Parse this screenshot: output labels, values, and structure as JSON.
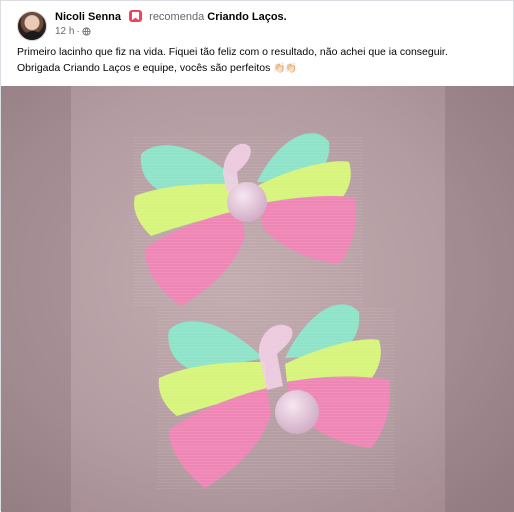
{
  "post": {
    "author": "Nicoli Senna",
    "recommendation_verb": "recomenda",
    "page_name": "Criando Laços.",
    "time": "12 h",
    "separator": "·",
    "body_line1": "Primeiro lacinho que fiz na vida. Fiquei tão feliz com o resultado, não achei que ia conseguir.",
    "body_line2": "Obrigada Criando Laços e equipe, vocês são perfeitos",
    "emoji": "👏🏻👏🏻"
  },
  "icons": {
    "recommend": "recommend-badge-icon",
    "audience": "globe-icon"
  },
  "colors": {
    "recommend_badge": "#f3425f",
    "ribbon_mint": "#8fe3c8",
    "ribbon_lime": "#d8f57a",
    "ribbon_pink": "#ee86b5",
    "pompom": "#e9c7dd",
    "background_fabric": "#b49ea3"
  }
}
